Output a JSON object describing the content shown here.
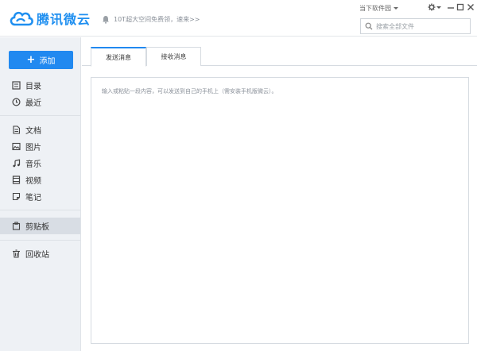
{
  "app": {
    "logo_text": "腾讯微云",
    "notice": "10T超大空间免费领，速来>>",
    "user": "当下软件园",
    "brand_color": "#2189f0"
  },
  "search": {
    "placeholder": "搜索全部文件"
  },
  "sidebar": {
    "add_label": "添加",
    "items": [
      {
        "label": "目录",
        "icon": "list-icon"
      },
      {
        "label": "最近",
        "icon": "clock-icon"
      },
      {
        "label": "文档",
        "icon": "document-icon"
      },
      {
        "label": "图片",
        "icon": "image-icon"
      },
      {
        "label": "音乐",
        "icon": "music-icon"
      },
      {
        "label": "视频",
        "icon": "video-icon"
      },
      {
        "label": "笔记",
        "icon": "note-icon"
      },
      {
        "label": "剪贴板",
        "icon": "clipboard-icon"
      },
      {
        "label": "回收站",
        "icon": "trash-icon"
      }
    ],
    "active": "剪贴板"
  },
  "main": {
    "tabs": [
      {
        "label": "发送消息",
        "active": true
      },
      {
        "label": "接收消息",
        "active": false
      }
    ],
    "editor_placeholder": "输入或粘贴一段内容，可以发送到自己的手机上（需安装手机版微云）。"
  }
}
